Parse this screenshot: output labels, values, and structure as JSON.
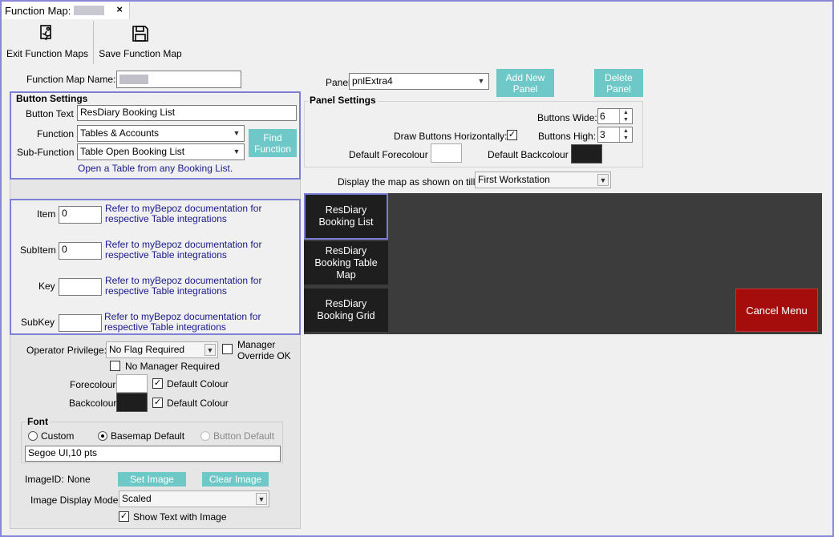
{
  "tab": {
    "title": "Function Map:"
  },
  "toolbar": {
    "exit_label": "Exit Function Maps",
    "save_label": "Save Function Map"
  },
  "function_map_name": {
    "label": "Function Map Name:"
  },
  "button_settings": {
    "title": "Button Settings",
    "button_text_label": "Button Text",
    "button_text_value": "ResDiary Booking List",
    "function_label": "Function",
    "function_value": "Tables & Accounts",
    "sub_function_label": "Sub-Function",
    "sub_function_value": "Table Open Booking List",
    "find_function_label": "Find Function",
    "description": "Open a Table from any Booking List."
  },
  "params": [
    {
      "label": "Item",
      "value": "0",
      "note": "Refer to myBepoz documentation for respective Table integrations"
    },
    {
      "label": "SubItem",
      "value": "0",
      "note": "Refer to myBepoz documentation for respective Table integrations"
    },
    {
      "label": "Key",
      "value": "",
      "note": "Refer to myBepoz documentation for respective Table integrations"
    },
    {
      "label": "SubKey",
      "value": "",
      "note": "Refer to myBepoz documentation for respective Table integrations"
    }
  ],
  "operator": {
    "privilege_label": "Operator Privilege:",
    "privilege_value": "No Flag Required",
    "manager_override_label": "Manager Override OK",
    "no_manager_label": "No Manager Required"
  },
  "colours": {
    "fore_label": "Forecolour",
    "back_label": "Backcolour",
    "default_colour_label": "Default Colour",
    "fore_hex": "#ffffff",
    "back_hex": "#1e1e1e"
  },
  "font": {
    "title": "Font",
    "options": [
      "Custom",
      "Basemap Default",
      "Button Default"
    ],
    "value": "Segoe UI,10 pts"
  },
  "image": {
    "id_label": "ImageID:",
    "id_value": "None",
    "set_label": "Set Image",
    "clear_label": "Clear Image",
    "mode_label": "Image Display Mode:",
    "mode_value": "Scaled",
    "show_text_label": "Show Text with Image"
  },
  "panel": {
    "label": "Panel",
    "value": "pnlExtra4",
    "add_label": "Add New Panel",
    "delete_label": "Delete Panel"
  },
  "panel_settings": {
    "title": "Panel Settings",
    "wide_label": "Buttons Wide:",
    "wide_value": "6",
    "high_label": "Buttons High:",
    "high_value": "3",
    "draw_horiz_label": "Draw Buttons Horizontally:",
    "default_fore_label": "Default Forecolour",
    "default_back_label": "Default Backcolour"
  },
  "display": {
    "label": "Display the map as shown on till:",
    "value": "First Workstation"
  },
  "map_buttons": [
    "ResDiary Booking List",
    "ResDiary Booking Table Map",
    "ResDiary Booking Grid"
  ],
  "cancel_label": "Cancel Menu",
  "accent_colors": {
    "teal": "#6fc8c8",
    "cancel_red": "#a50d0d",
    "selection_blue": "#7c7fd3"
  }
}
